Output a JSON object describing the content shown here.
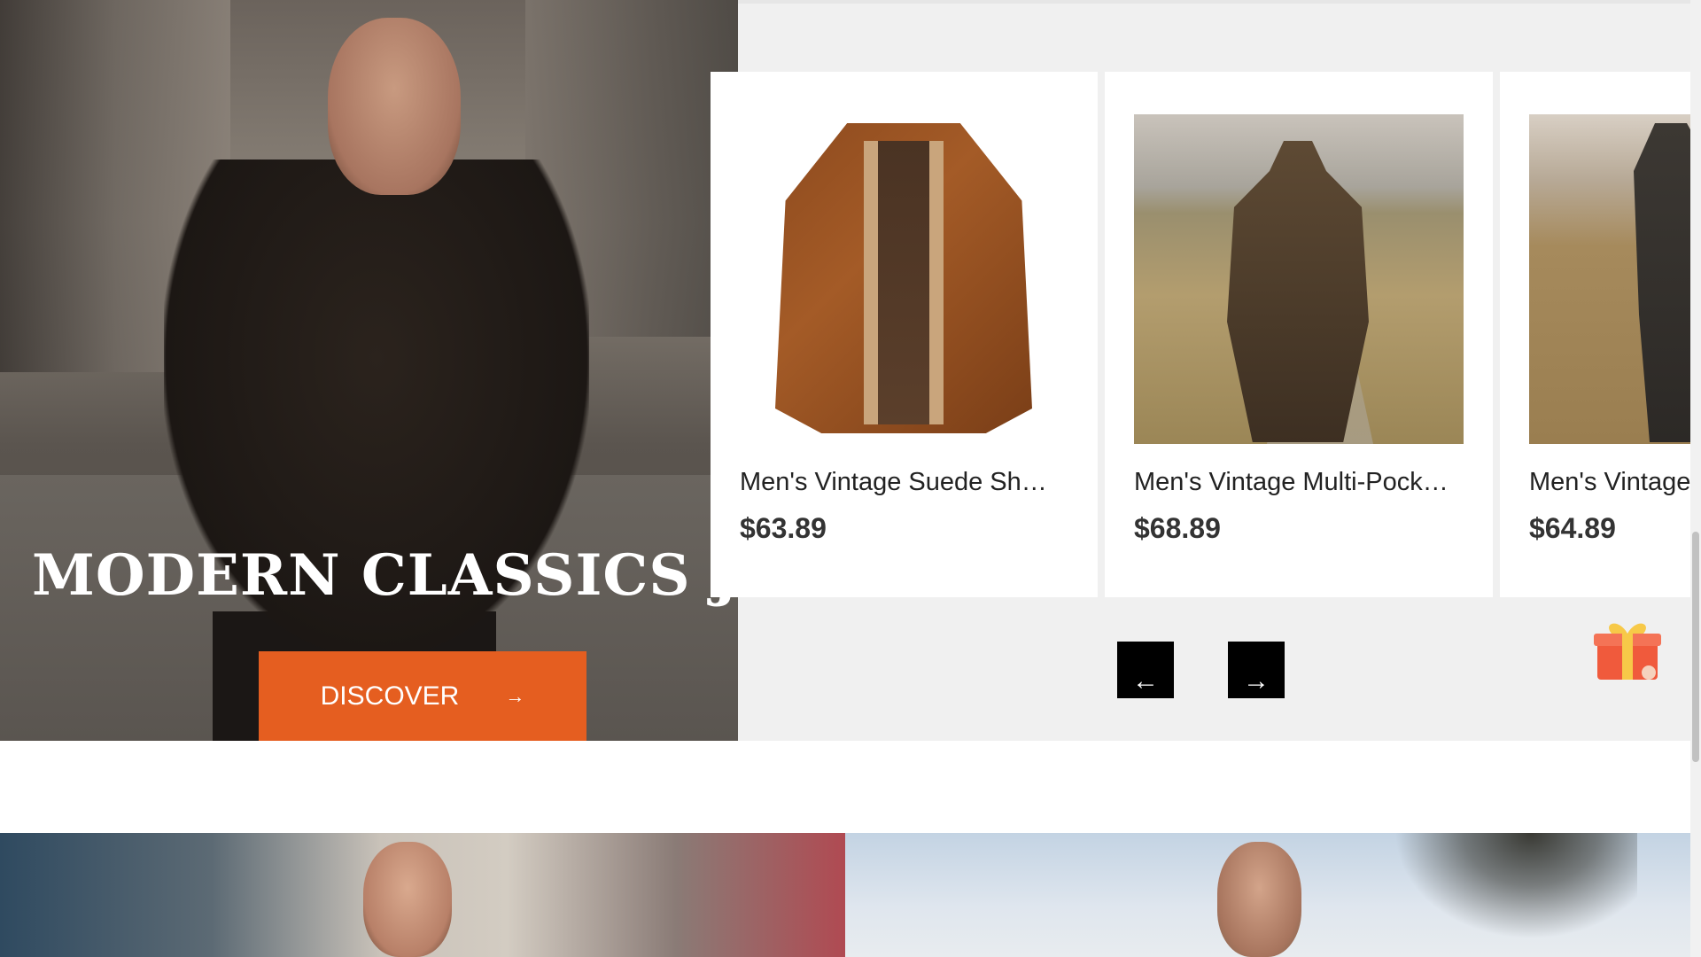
{
  "hero": {
    "title": "MODERN CLASSICS JACKETS",
    "button_label": "DISCOVER",
    "button_arrow": "→"
  },
  "products": [
    {
      "name": "Men's Vintage Suede Sh…",
      "price": "$63.89"
    },
    {
      "name": "Men's Vintage Multi-Pock…",
      "price": "$68.89"
    },
    {
      "name": "Men's Vintage",
      "price": "$64.89"
    }
  ],
  "carousel": {
    "prev_symbol": "←",
    "next_symbol": "→"
  },
  "colors": {
    "accent": "#e55e20",
    "panel_bg": "#f0f0f0",
    "nav_button": "#000000"
  },
  "icons": {
    "gift": "gift-icon"
  }
}
